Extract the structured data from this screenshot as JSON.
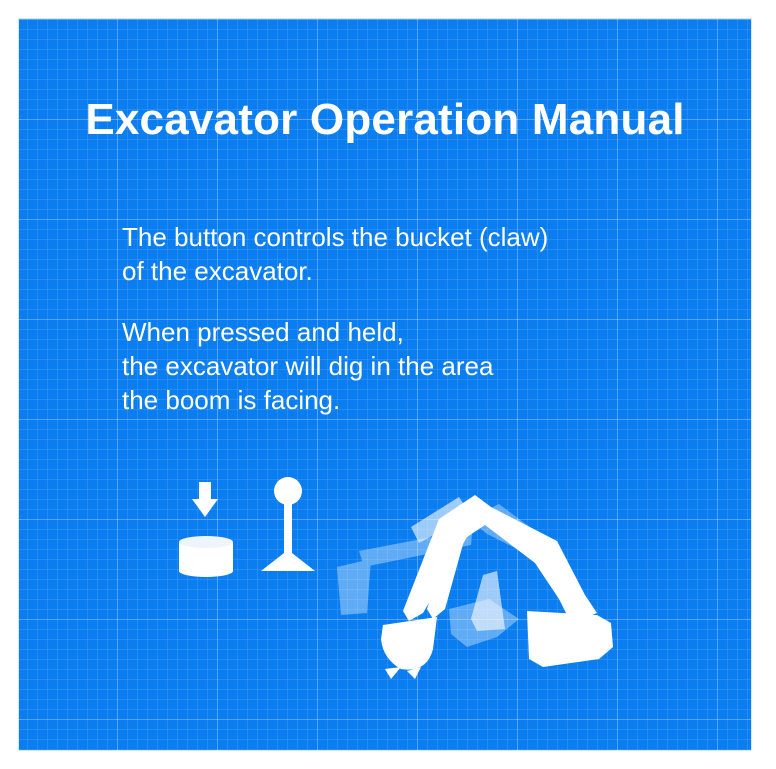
{
  "manual": {
    "title": "Excavator Operation Manual",
    "paragraph1": [
      "The button controls the bucket (claw)",
      "of the excavator."
    ],
    "paragraph2": [
      "When pressed and held,",
      "the excavator will dig in the area",
      "the boom is facing."
    ]
  },
  "illustration": {
    "icons": [
      "press-arrow-icon",
      "button-icon",
      "joystick-icon",
      "excavator-icon"
    ],
    "colors": {
      "background": "#0a7ef0",
      "grid": "#ffffff",
      "foreground": "#ffffff"
    }
  }
}
